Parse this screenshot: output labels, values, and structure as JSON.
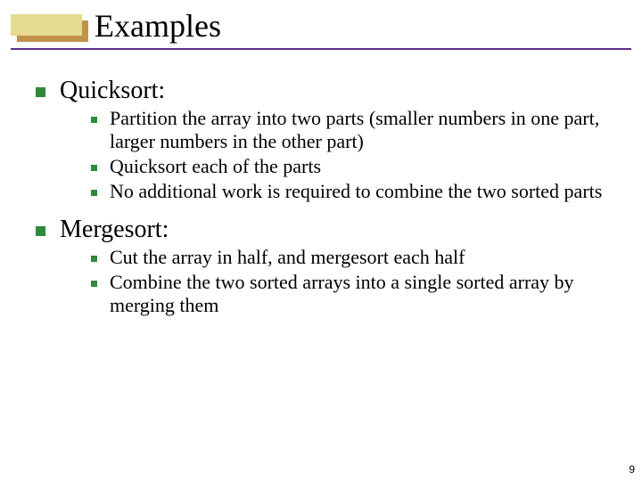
{
  "title": "Examples",
  "sections": [
    {
      "heading": "Quicksort:",
      "items": [
        "Partition the array into two parts (smaller numbers in one part, larger numbers in the other part)",
        "Quicksort each of the parts",
        "No additional work is required to combine the two sorted parts"
      ]
    },
    {
      "heading": "Mergesort:",
      "items": [
        "Cut the array in half, and mergesort each half",
        "Combine the two sorted arrays into a single sorted array by merging them"
      ]
    }
  ],
  "page_number": "9",
  "colors": {
    "bullet": "#2f8a3a",
    "underline": "#5a2f88",
    "accent_light": "#e4da90",
    "accent_shadow": "#c2914a"
  }
}
